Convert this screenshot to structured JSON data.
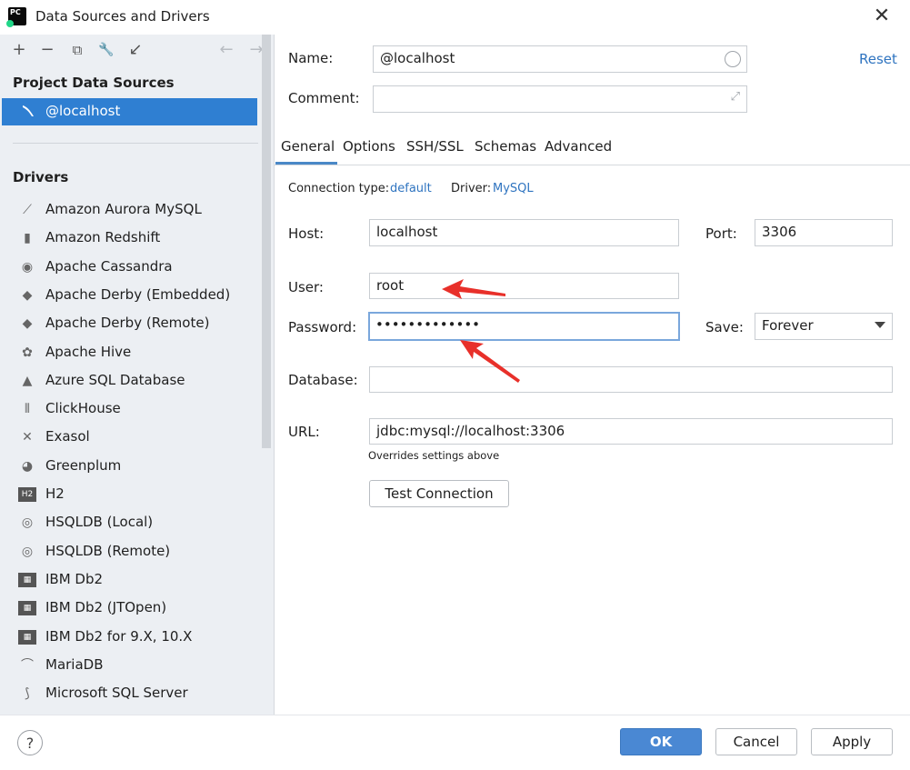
{
  "window": {
    "title": "Data Sources and Drivers",
    "close": "✕"
  },
  "toolbar": {
    "add": "+",
    "remove": "−",
    "duplicate": "⧉",
    "settings": "🔧",
    "import": "↙",
    "back": "←",
    "forward": "→"
  },
  "project": {
    "header": "Project Data Sources",
    "selected": "@localhost"
  },
  "drivers": {
    "header": "Drivers",
    "items": [
      {
        "label": "Amazon Aurora MySQL",
        "icon": "dolphin-icon"
      },
      {
        "label": "Amazon Redshift",
        "icon": "redshift-icon"
      },
      {
        "label": "Apache Cassandra",
        "icon": "cassandra-icon"
      },
      {
        "label": "Apache Derby (Embedded)",
        "icon": "derby-icon"
      },
      {
        "label": "Apache Derby (Remote)",
        "icon": "derby-icon"
      },
      {
        "label": "Apache Hive",
        "icon": "hive-icon"
      },
      {
        "label": "Azure SQL Database",
        "icon": "azure-icon"
      },
      {
        "label": "ClickHouse",
        "icon": "clickhouse-icon"
      },
      {
        "label": "Exasol",
        "icon": "exasol-icon"
      },
      {
        "label": "Greenplum",
        "icon": "greenplum-icon"
      },
      {
        "label": "H2",
        "icon": "h2-icon"
      },
      {
        "label": "HSQLDB (Local)",
        "icon": "hsqldb-icon"
      },
      {
        "label": "HSQLDB (Remote)",
        "icon": "hsqldb-icon"
      },
      {
        "label": "IBM Db2",
        "icon": "db2-icon"
      },
      {
        "label": "IBM Db2 (JTOpen)",
        "icon": "db2-icon"
      },
      {
        "label": "IBM Db2 for 9.X, 10.X",
        "icon": "db2-icon"
      },
      {
        "label": "MariaDB",
        "icon": "mariadb-icon"
      },
      {
        "label": "Microsoft SQL Server",
        "icon": "sqlserver-icon"
      }
    ]
  },
  "form": {
    "name_label": "Name:",
    "name_value": "@localhost",
    "comment_label": "Comment:",
    "comment_value": "",
    "reset": "Reset",
    "tabs": [
      "General",
      "Options",
      "SSH/SSL",
      "Schemas",
      "Advanced"
    ],
    "connection_type_label": "Connection type:",
    "connection_type_value": "default",
    "driver_label": "Driver:",
    "driver_value": "MySQL",
    "host_label": "Host:",
    "host_value": "localhost",
    "port_label": "Port:",
    "port_value": "3306",
    "user_label": "User:",
    "user_value": "root",
    "password_label": "Password:",
    "password_value": "•••••••••••••",
    "save_label": "Save:",
    "save_value": "Forever",
    "database_label": "Database:",
    "database_value": "",
    "url_label": "URL:",
    "url_value": "jdbc:mysql://localhost:3306",
    "url_note": "Overrides settings above",
    "test_connection": "Test Connection"
  },
  "footer": {
    "help": "?",
    "ok": "OK",
    "cancel": "Cancel",
    "apply": "Apply"
  },
  "colors": {
    "accent": "#2f7fd2",
    "link": "#2f74c0",
    "annotation_arrow": "#e8302a"
  }
}
